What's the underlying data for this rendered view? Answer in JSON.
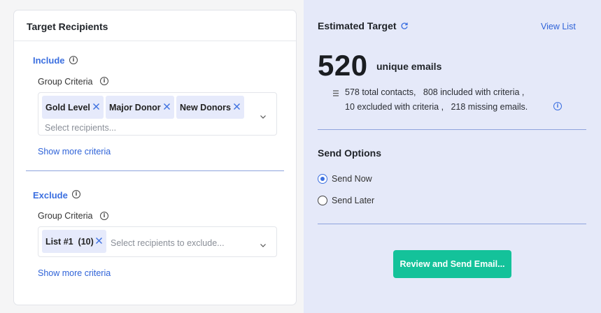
{
  "target_recipients": {
    "title": "Target Recipients",
    "include": {
      "title": "Include",
      "group_criteria_label": "Group Criteria",
      "chips": [
        "Gold Level",
        "Major Donor",
        "New Donors"
      ],
      "placeholder": "Select recipients...",
      "show_more": "Show more criteria"
    },
    "exclude": {
      "title": "Exclude",
      "group_criteria_label": "Group Criteria",
      "chips": [
        "List #1  (10)"
      ],
      "placeholder": "Select recipients to exclude...",
      "show_more": "Show more criteria"
    }
  },
  "estimated_target": {
    "title": "Estimated Target",
    "view_list": "View List",
    "count": "520",
    "count_suffix": "unique emails",
    "stats_line1": "578 total contacts,   808 included with criteria ,",
    "stats_line2": "10 excluded with criteria ,   218 missing emails."
  },
  "send_options": {
    "title": "Send Options",
    "options": [
      {
        "label": "Send Now",
        "checked": true
      },
      {
        "label": "Send Later",
        "checked": false
      }
    ],
    "submit": "Review and Send Email..."
  },
  "colors": {
    "accent": "#3b6fe0",
    "link": "#2f63d8",
    "primary_button": "#14c29a",
    "chip_bg": "#e6eafb",
    "right_panel_bg": "#e5e9f9"
  }
}
